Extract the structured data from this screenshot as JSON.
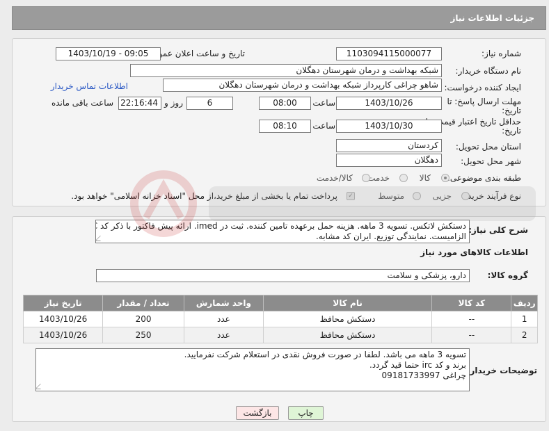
{
  "header": {
    "title": "جزئیات اطلاعات نیاز"
  },
  "form": {
    "need_number": {
      "label": "شماره نیاز:",
      "value": "1103094115000077"
    },
    "announce_datetime": {
      "label": "تاریخ و ساعت اعلان عمومی:",
      "value": "1403/10/19 - 09:05"
    },
    "buyer_org": {
      "label": "نام دستگاه خریدار:",
      "value": "شبکه بهداشت و درمان شهرستان دهگلان"
    },
    "requester": {
      "label": "ایجاد کننده درخواست:",
      "value": "شاهو چراغی کارپرداز شبکه بهداشت و درمان شهرستان دهگلان",
      "contact_link": "اطلاعات تماس خریدار"
    },
    "response_deadline": {
      "label_line1": "مهلت ارسال پاسخ: تا",
      "label_line2": "تاریخ:",
      "date": "1403/10/26",
      "time_label": "ساعت",
      "time": "08:00",
      "days": "6",
      "days_label": "روز و",
      "remaining": "22:16:44",
      "remaining_label": "ساعت باقی مانده"
    },
    "price_validity": {
      "label_line1": "حداقل تاریخ اعتبار قیمت: تا",
      "label_line2": "تاریخ:",
      "date": "1403/10/30",
      "time_label": "ساعت",
      "time": "08:10"
    },
    "province": {
      "label": "استان محل تحویل:",
      "value": "کردستان"
    },
    "city": {
      "label": "شهر محل تحویل:",
      "value": "دهگلان"
    },
    "category": {
      "label": "طبقه بندی موضوعی:",
      "options": [
        "کالا",
        "خدمت",
        "کالا/خدمت"
      ],
      "selected": "کالا"
    },
    "purchase_process": {
      "label": "نوع فرآیند خرید :",
      "options": [
        "جزیی",
        "متوسط"
      ],
      "note": "پرداخت تمام یا بخشی از مبلغ خرید،از محل \"اسناد خزانه اسلامی\" خواهد بود."
    }
  },
  "description": {
    "label": "شرح کلی نیاز:",
    "lines": [
      "دستکش لاتکس. تسویه 3 ماهه. هزینه حمل برعهده تامین کننده. ثبت در imed. ارائه پیش فاکتور با ذکر کد IRC",
      "الزامیست. نمایندگی توزیع. ایران کد مشابه."
    ]
  },
  "goods": {
    "section_title": "اطلاعات کالاهای مورد نیاز",
    "group_label": "گروه کالا:",
    "group_value": "دارو، پزشکی و سلامت",
    "columns": [
      "ردیف",
      "کد کالا",
      "نام کالا",
      "واحد شمارش",
      "تعداد / مقدار",
      "تاریخ نیاز"
    ],
    "rows": [
      {
        "row": "1",
        "code": "--",
        "name": "دستکش محافظ",
        "unit": "عدد",
        "qty": "200",
        "date": "1403/10/26"
      },
      {
        "row": "2",
        "code": "--",
        "name": "دستکش محافظ",
        "unit": "عدد",
        "qty": "250",
        "date": "1403/10/26"
      }
    ]
  },
  "buyer_notes": {
    "label": "توضیحات خریدار:",
    "lines": [
      "تسویه 3 ماهه می باشد. لطفا در صورت فروش نقدی در استعلام شرکت نفرمایید.",
      "برند و کد irc حتما قید گردد.",
      "چراغی 09181733997"
    ]
  },
  "buttons": {
    "print": "چاپ",
    "back": "بازگشت"
  },
  "colors": {
    "header_bg": "#9b9b9b",
    "table_header_bg": "#8c8c8c",
    "link": "#2a58c4",
    "print_btn": "#dff5d6",
    "back_btn": "#fde6e6"
  }
}
